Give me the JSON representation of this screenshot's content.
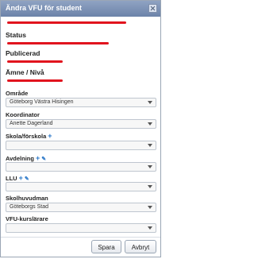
{
  "dialog": {
    "title": "Ändra VFU för student"
  },
  "sections": {
    "status_label": "Status",
    "publicerad_label": "Publicerad",
    "amne_label": "Ämne / Nivå"
  },
  "fields": {
    "omrade": {
      "label": "Område",
      "value": "Göteborg Västra Hisingen"
    },
    "koordinator": {
      "label": "Koordinator",
      "value": "Anette Dagerland"
    },
    "skola": {
      "label": "Skola/förskola",
      "value": ""
    },
    "avdelning": {
      "label": "Avdelning",
      "value": ""
    },
    "llu": {
      "label": "LLU",
      "value": ""
    },
    "skolhuvudman": {
      "label": "Skolhuvudman",
      "value": "Göteborgs Stad"
    },
    "vfu": {
      "label": "VFU-kurslärare",
      "value": ""
    }
  },
  "icons": {
    "plus": "+",
    "edit": "✎"
  },
  "buttons": {
    "save": "Spara",
    "cancel": "Avbryt"
  },
  "colors": {
    "titlebar": "#7a8fb3",
    "accent": "#2a77c8",
    "redaction": "#e1141e"
  }
}
